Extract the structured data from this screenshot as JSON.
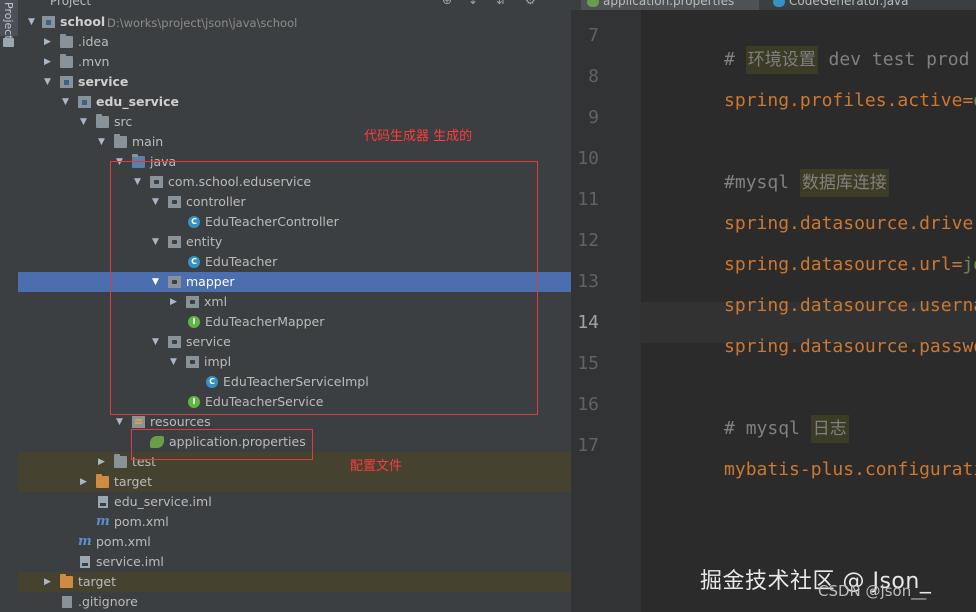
{
  "side_tab": {
    "label": "Project"
  },
  "panel": {
    "title": "Project"
  },
  "tree": [
    {
      "label": "school",
      "path": "D:\\works\\project\\json\\java\\school"
    },
    {
      "label": ".idea"
    },
    {
      "label": ".mvn"
    },
    {
      "label": "service"
    },
    {
      "label": "edu_service"
    },
    {
      "label": "src"
    },
    {
      "label": "main"
    },
    {
      "label": "java"
    },
    {
      "label": "com.school.eduservice"
    },
    {
      "label": "controller"
    },
    {
      "label": "EduTeacherController"
    },
    {
      "label": "entity"
    },
    {
      "label": "EduTeacher"
    },
    {
      "label": "mapper"
    },
    {
      "label": "xml"
    },
    {
      "label": "EduTeacherMapper"
    },
    {
      "label": "service"
    },
    {
      "label": "impl"
    },
    {
      "label": "EduTeacherServiceImpl"
    },
    {
      "label": "EduTeacherService"
    },
    {
      "label": "resources"
    },
    {
      "label": "application.properties"
    },
    {
      "label": "test"
    },
    {
      "label": "target"
    },
    {
      "label": "edu_service.iml"
    },
    {
      "label": "pom.xml"
    },
    {
      "label": "pom.xml"
    },
    {
      "label": "service.iml"
    },
    {
      "label": "target"
    },
    {
      "label": ".gitignore"
    }
  ],
  "notes": {
    "generator": "代码生成器 生成的",
    "config": "配置文件"
  },
  "editor": {
    "tabs": [
      {
        "label": "application.properties"
      },
      {
        "label": "CodeGenerator.java"
      }
    ],
    "line_numbers": [
      "7",
      "8",
      "9",
      "10",
      "11",
      "12",
      "13",
      "14",
      "15",
      "16",
      "17"
    ],
    "current_line": "14",
    "code": {
      "l7_hash": "# ",
      "l7_cjk": "环境设置",
      "l7_rest": " dev test prod",
      "l8_key": "spring.profiles.active",
      "l8_eq": "=",
      "l8_val": "dev",
      "l10_hash": "#mysql ",
      "l10_cjk": "数据库连接",
      "l11_key": "spring.datasource.driver-cl",
      "l12_key": "spring.datasource.url",
      "l12_eq": "=",
      "l12_val": "jdbc",
      "l13_key": "spring.datasource.username",
      "l13_eq": "=",
      "l14_key": "spring.datasource.password",
      "l14_eq": "=",
      "l16_hash": "# mysql ",
      "l16_cjk": "日志",
      "l17_key": "mybatis-plus.configuration"
    }
  },
  "watermark": {
    "main": "掘金技术社区 @ Json_",
    "sub": "CSDN @json__"
  },
  "colors": {
    "selection": "#4b6eaf",
    "annotation_red": "#e23a3a",
    "property_key": "#cc7832",
    "property_value": "#6a8759",
    "comment": "#808080"
  }
}
